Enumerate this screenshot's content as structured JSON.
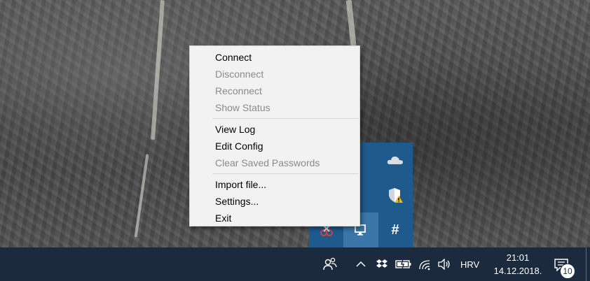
{
  "context_menu": {
    "items": [
      {
        "label": "Connect",
        "enabled": true
      },
      {
        "label": "Disconnect",
        "enabled": false
      },
      {
        "label": "Reconnect",
        "enabled": false
      },
      {
        "label": "Show Status",
        "enabled": false
      },
      {
        "separator": true
      },
      {
        "label": "View Log",
        "enabled": true
      },
      {
        "label": "Edit Config",
        "enabled": true
      },
      {
        "label": "Clear Saved Passwords",
        "enabled": false
      },
      {
        "separator": true
      },
      {
        "label": "Import file...",
        "enabled": true
      },
      {
        "label": "Settings...",
        "enabled": true
      },
      {
        "label": "Exit",
        "enabled": true
      }
    ]
  },
  "tray_overflow": {
    "icons": [
      "bluetooth-icon",
      "onedrive-cloud-icon",
      "dropbox-sync-icon",
      "windows-defender-warning-icon",
      "snipping-tool-icon",
      "openvpn-monitor-icon",
      "hashtag-icon"
    ]
  },
  "taskbar": {
    "language": "HRV",
    "time": "21:01",
    "date": "14.12.2018.",
    "notification_count": "10",
    "background_color": "#1b2a3d"
  }
}
